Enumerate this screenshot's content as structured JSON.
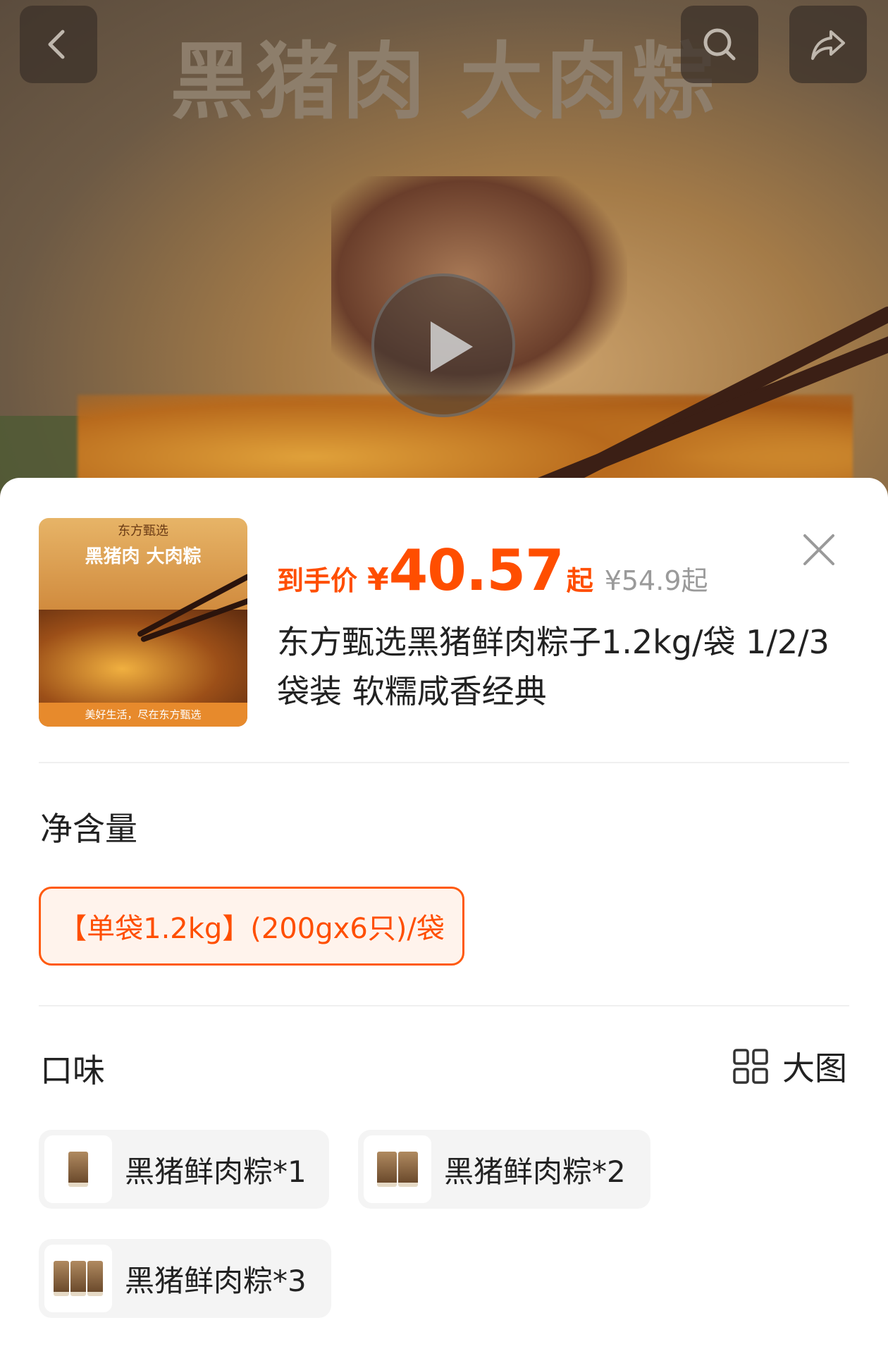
{
  "hero": {
    "title": "黑猪肉 大肉粽"
  },
  "icons": {
    "back": "chevron-left-icon",
    "search": "search-icon",
    "share": "share-icon",
    "play": "play-icon",
    "close": "close-icon",
    "grid": "grid-icon"
  },
  "product": {
    "thumb_brand": "东方甄选",
    "thumb_title": "黑猪肉 大肉粽",
    "thumb_slogan": "美好生活，尽在东方甄选",
    "price_label": "到手价",
    "price_currency": "¥",
    "price_value": "40.57",
    "price_suffix": "起",
    "original_price": "¥54.9起",
    "title": "东方甄选黑猪鲜肉粽子1.2kg/袋 1/2/3袋装 软糯咸香经典"
  },
  "net_weight": {
    "section_title": "净含量",
    "options": [
      {
        "label": "【单袋1.2kg】(200gx6只)/袋",
        "selected": true
      }
    ]
  },
  "flavor": {
    "section_title": "口味",
    "big_image_label": "大图",
    "options": [
      {
        "label": "黑猪鲜肉粽*1",
        "bags": 1
      },
      {
        "label": "黑猪鲜肉粽*2",
        "bags": 2
      },
      {
        "label": "黑猪鲜肉粽*3",
        "bags": 3
      }
    ]
  },
  "colors": {
    "accent": "#ff4e00",
    "accent_border": "#ff5a0e",
    "chip_selected_bg": "#fff3ec",
    "chip_bg": "#f4f4f4",
    "muted": "#9a9a9a"
  }
}
